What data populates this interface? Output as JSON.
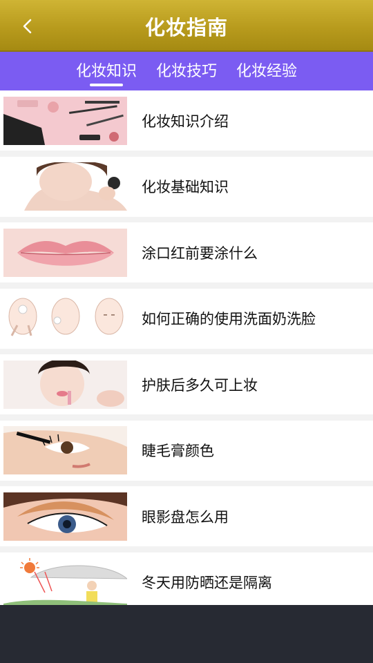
{
  "header": {
    "title": "化妆指南",
    "back_icon": "chevron-left-icon",
    "gradient_colors": [
      "#cfb434",
      "#a58a12"
    ]
  },
  "tabs": [
    {
      "label": "化妆知识",
      "active": true
    },
    {
      "label": "化妆技巧",
      "active": false
    },
    {
      "label": "化妆经验",
      "active": false
    }
  ],
  "tab_bar_color": "#7b5cf2",
  "articles": [
    {
      "title": "化妆知识介绍",
      "image": "makeup-tools-flatlay"
    },
    {
      "title": "化妆基础知识",
      "image": "woman-applying-blush"
    },
    {
      "title": "涂口红前要涂什么",
      "image": "pink-lips-closeup"
    },
    {
      "title": "如何正确的使用洗面奶洗脸",
      "image": "face-washing-steps"
    },
    {
      "title": "护肤后多久可上妆",
      "image": "woman-with-lipstick"
    },
    {
      "title": "睫毛膏颜色",
      "image": "mascara-application"
    },
    {
      "title": "眼影盘怎么用",
      "image": "eyeshadow-eye-closeup"
    },
    {
      "title": "冬天用防晒还是隔离",
      "image": "sun-umbrella-illustration"
    }
  ],
  "bottom_bar_color": "#272a33"
}
